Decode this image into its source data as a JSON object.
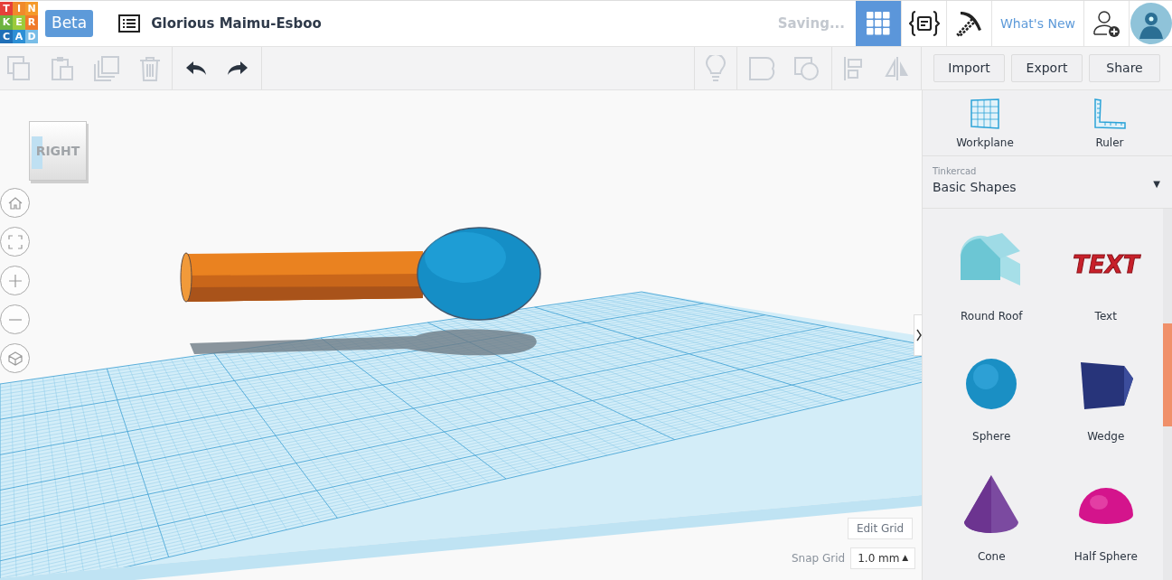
{
  "logo_letters": [
    "T",
    "I",
    "N",
    "K",
    "E",
    "R",
    "C",
    "A",
    "D"
  ],
  "beta_badge": "Beta",
  "design_title": "Glorious Maimu-Esboo",
  "save_status": "Saving...",
  "header_views": [
    {
      "kind": "grid",
      "selected": true
    },
    {
      "kind": "codeblocks",
      "selected": false
    },
    {
      "kind": "pickaxe",
      "selected": false
    }
  ],
  "whats_new": "What's New",
  "toolbar_right_buttons": [
    "Import",
    "Export",
    "Share"
  ],
  "view_cube": {
    "face": "RIGHT"
  },
  "edit_grid": "Edit Grid",
  "snap_grid": {
    "label": "Snap Grid",
    "value": "1.0 mm",
    "arrow": "▲"
  },
  "sidebar": {
    "tools": [
      {
        "kind": "workplane",
        "label": "Workplane"
      },
      {
        "kind": "ruler",
        "label": "Ruler"
      }
    ],
    "library": {
      "source": "Tinkercad",
      "name": "Basic Shapes",
      "arrow": "▼"
    },
    "text_shape_art": "TEXT",
    "shapes": [
      {
        "kind": "roundroof",
        "label": "Round Roof",
        "color": "#6cc6d4"
      },
      {
        "kind": "text",
        "label": "Text",
        "color": "#c8202a"
      },
      {
        "kind": "sphere",
        "label": "Sphere",
        "color": "#1a8fc4"
      },
      {
        "kind": "wedge",
        "label": "Wedge",
        "color": "#27347a"
      },
      {
        "kind": "cone",
        "label": "Cone",
        "color": "#6c3490"
      },
      {
        "kind": "halfsphere",
        "label": "Half Sphere",
        "color": "#d4148c"
      }
    ]
  }
}
